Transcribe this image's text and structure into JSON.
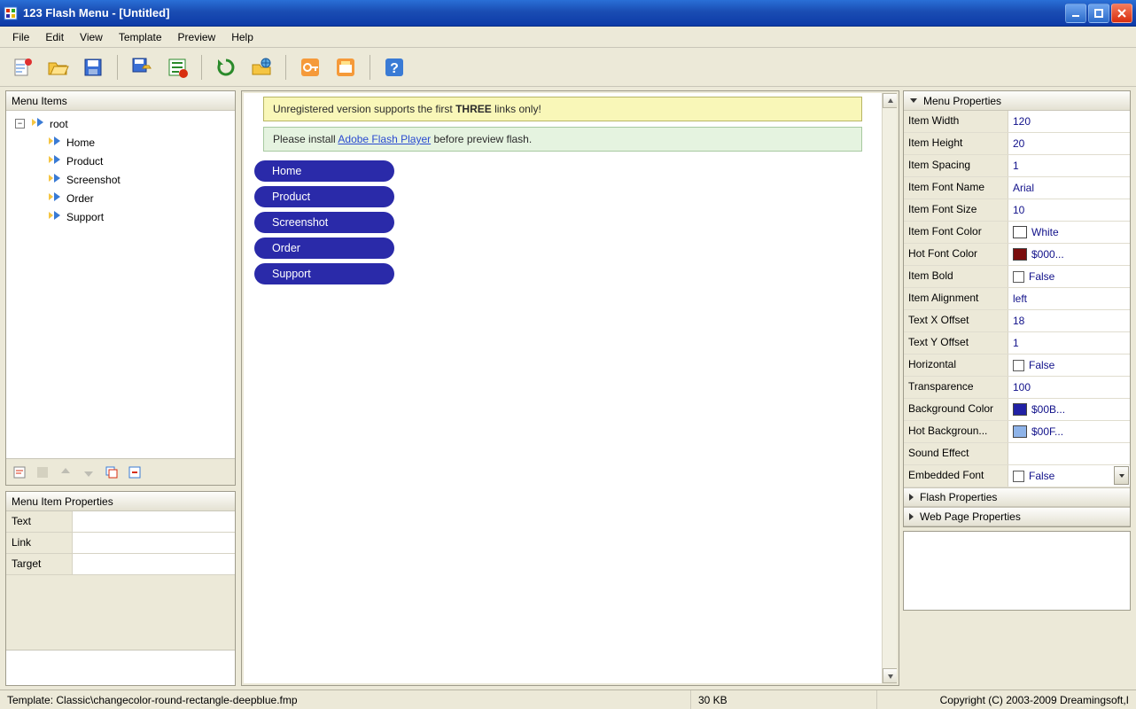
{
  "titlebar": {
    "title": "123 Flash Menu - [Untitled]"
  },
  "menubar": [
    "File",
    "Edit",
    "View",
    "Template",
    "Preview",
    "Help"
  ],
  "toolbar": [
    {
      "name": "new-icon"
    },
    {
      "name": "open-icon"
    },
    {
      "name": "save-icon"
    },
    {
      "sep": true
    },
    {
      "name": "save-as-icon"
    },
    {
      "name": "export-icon"
    },
    {
      "sep": true
    },
    {
      "name": "refresh-icon"
    },
    {
      "name": "preview-browser-icon"
    },
    {
      "sep": true
    },
    {
      "name": "key-icon"
    },
    {
      "name": "register-icon"
    },
    {
      "sep": true
    },
    {
      "name": "help-icon"
    }
  ],
  "tree": {
    "header": "Menu Items",
    "root": "root",
    "items": [
      "Home",
      "Product",
      "Screenshot",
      "Order",
      "Support"
    ],
    "mini_toolbar": [
      {
        "name": "add-item-icon",
        "disabled": false
      },
      {
        "name": "add-child-icon",
        "disabled": true
      },
      {
        "name": "move-up-icon",
        "disabled": true
      },
      {
        "name": "move-down-icon",
        "disabled": true
      },
      {
        "name": "copy-item-icon",
        "disabled": false
      },
      {
        "name": "delete-item-icon",
        "disabled": false
      }
    ]
  },
  "item_props": {
    "header": "Menu Item Properties",
    "rows": [
      {
        "label": "Text",
        "value": ""
      },
      {
        "label": "Link",
        "value": ""
      },
      {
        "label": "Target",
        "value": ""
      }
    ]
  },
  "preview": {
    "notice1_pre": "Unregistered version supports the first ",
    "notice1_bold": "THREE",
    "notice1_post": " links only!",
    "notice2_pre": "Please install ",
    "notice2_link": "Adobe Flash Player",
    "notice2_post": " before preview flash.",
    "menu_items": [
      "Home",
      "Product",
      "Screenshot",
      "Order",
      "Support"
    ]
  },
  "menu_props": {
    "header": "Menu Properties",
    "rows": [
      {
        "label": "Item Width",
        "value": "120"
      },
      {
        "label": "Item Height",
        "value": "20"
      },
      {
        "label": "Item Spacing",
        "value": "1"
      },
      {
        "label": "Item Font Name",
        "value": "Arial"
      },
      {
        "label": "Item Font Size",
        "value": "10"
      },
      {
        "label": "Item Font Color",
        "value": "White",
        "swatch": "#ffffff"
      },
      {
        "label": "Hot Font Color",
        "value": "$000...",
        "swatch": "#7a0d0d"
      },
      {
        "label": "Item Bold",
        "value": "False",
        "check": true
      },
      {
        "label": "Item Alignment",
        "value": "left"
      },
      {
        "label": "Text X Offset",
        "value": "18"
      },
      {
        "label": "Text Y Offset",
        "value": "1"
      },
      {
        "label": "Horizontal",
        "value": "False",
        "check": true
      },
      {
        "label": "Transparence",
        "value": "100"
      },
      {
        "label": "Background Color",
        "value": "$00B...",
        "swatch": "#2121a5"
      },
      {
        "label": "Hot Backgroun...",
        "value": "$00F...",
        "swatch": "#8eb3e8"
      },
      {
        "label": "Sound Effect",
        "value": ""
      },
      {
        "label": "Embedded Font",
        "value": "False",
        "check": true,
        "dropdown": true
      }
    ],
    "sections": [
      "Flash Properties",
      "Web Page Properties"
    ]
  },
  "status": {
    "template_label": "Template:",
    "template_value": "Classic\\changecolor-round-rectangle-deepblue.fmp",
    "size": "30 KB",
    "copyright": "Copyright (C) 2003-2009 Dreamingsoft,I"
  }
}
